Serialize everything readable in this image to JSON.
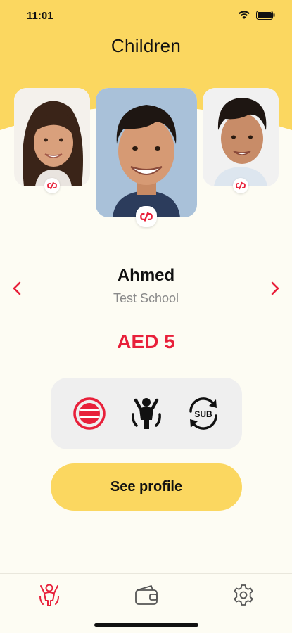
{
  "status_bar": {
    "time": "11:01",
    "icons": [
      "wifi-icon",
      "battery-icon"
    ]
  },
  "header": {
    "title": "Children"
  },
  "children": [
    {
      "position": "previous",
      "photo": "girl-avatar",
      "badge": "unlink-icon"
    },
    {
      "position": "selected",
      "photo": "boy-avatar",
      "badge": "unlink-icon"
    },
    {
      "position": "next",
      "photo": "boy-avatar-2",
      "badge": "unlink-icon"
    }
  ],
  "selected_child": {
    "name": "Ahmed",
    "school": "Test School",
    "balance": "AED 5"
  },
  "actions": [
    {
      "name": "limit-icon"
    },
    {
      "name": "child-icon"
    },
    {
      "name": "subscription-icon"
    }
  ],
  "buttons": {
    "see_profile": "See profile"
  },
  "tab_bar": {
    "tabs": [
      "children-tab-icon",
      "wallet-icon",
      "gear-icon"
    ]
  },
  "colors": {
    "accent": "#fbd760",
    "brand_red": "#e8203a",
    "background": "#fdfcf3",
    "panel": "#efefef"
  }
}
